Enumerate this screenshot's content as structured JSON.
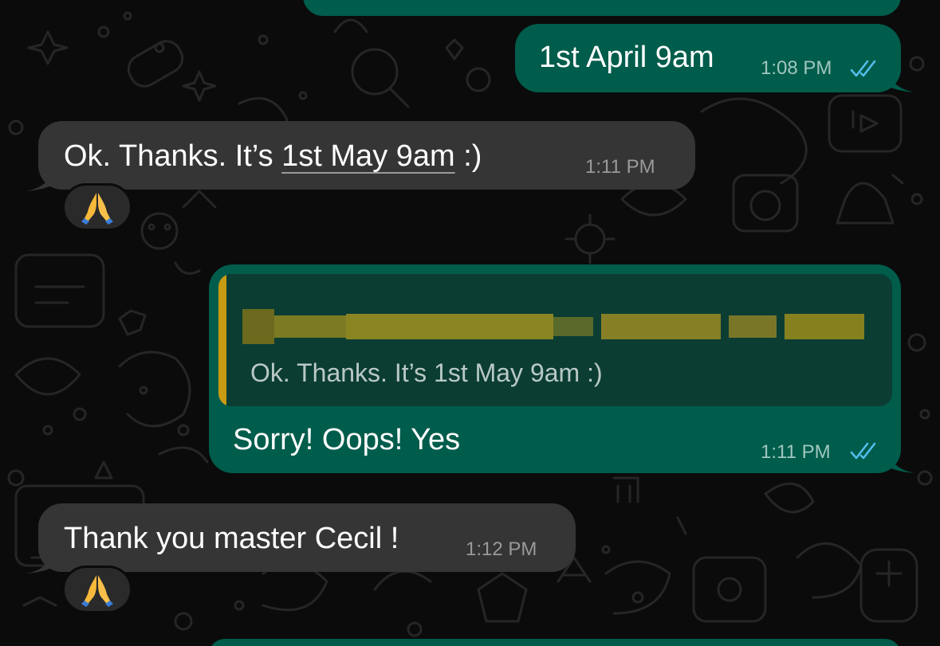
{
  "messages": [
    {
      "id": "m1",
      "direction": "outgoing",
      "text": "1st April 9am",
      "time": "1:08 PM",
      "read_receipt_icon": "double-check-blue"
    },
    {
      "id": "m2",
      "direction": "incoming",
      "text_before_link": "Ok. Thanks. It’s ",
      "link_text": "1st May 9am",
      "text_after_link": " :)",
      "time": "1:11 PM",
      "reaction": "folded-hands-emoji"
    },
    {
      "id": "m3",
      "direction": "outgoing",
      "quoted_author_redacted": true,
      "quoted_text": "Ok. Thanks. It’s 1st May 9am :)",
      "text": "Sorry! Oops! Yes",
      "time": "1:11 PM",
      "read_receipt_icon": "double-check-blue"
    },
    {
      "id": "m4",
      "direction": "incoming",
      "text": "Thank you master Cecil !",
      "time": "1:12 PM",
      "reaction": "folded-hands-emoji"
    }
  ],
  "colors": {
    "background": "#0b0b0b",
    "outgoing_bubble": "#005c4b",
    "incoming_bubble": "#353535",
    "quote_accent": "#c99b12",
    "read_tick": "#53bdeb"
  }
}
